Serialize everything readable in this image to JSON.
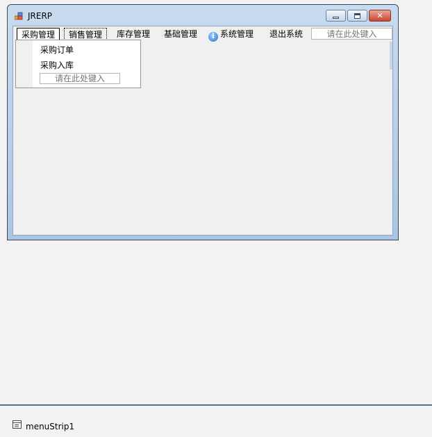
{
  "window": {
    "title": "JRERP",
    "close_glyph": "✕"
  },
  "menu": {
    "items": [
      {
        "label": "采购管理"
      },
      {
        "label": "销售管理"
      },
      {
        "label": "库存管理"
      },
      {
        "label": "基础管理"
      },
      {
        "label": "系统管理",
        "icon": "info-icon"
      },
      {
        "label": "退出系统"
      }
    ],
    "textbox_placeholder": "请在此处键入"
  },
  "dropdown": {
    "items": [
      {
        "label": "采购订单"
      },
      {
        "label": "采购入库"
      }
    ],
    "textbox_placeholder": "请在此处键入"
  },
  "tray": {
    "component_label": "menuStrip1"
  },
  "colors": {
    "title_gradient_top": "#c9dbef",
    "title_gradient_bottom": "#aac5e3",
    "close_button": "#c9452e",
    "client_bg": "#f0f0f0"
  }
}
